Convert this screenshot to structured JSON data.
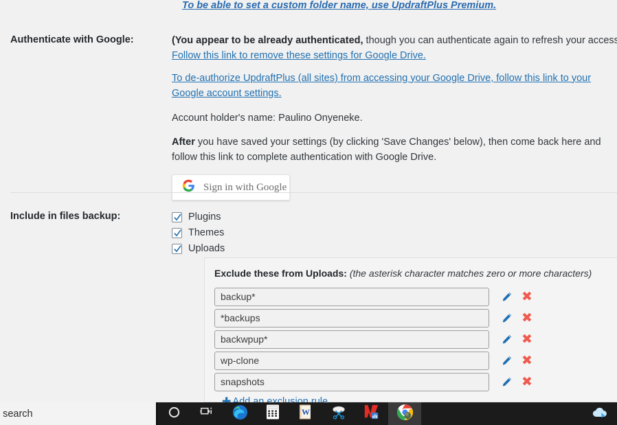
{
  "settings": {
    "premium_link": "To be able to set a custom folder name, use UpdraftPlus Premium.",
    "auth_section": {
      "label": "Authenticate with Google:",
      "para1_bold": "(You appear to be already authenticated,",
      "para1_rest": " though you can authenticate again to refresh your access if you've had a problem). ",
      "para1_link": "Follow this link to remove these settings for Google Drive.",
      "para2_link": "To de-authorize UpdraftPlus (all sites) from accessing your Google Drive, follow this link to your Google account settings.",
      "account_holder": "Account holder's name: Paulino Onyeneke.",
      "para3_bold": "After",
      "para3_rest": " you have saved your settings (by clicking 'Save Changes' below), then come back here and follow this link to complete authentication with Google Drive.",
      "google_button": "Sign in with Google"
    },
    "files_section": {
      "label": "Include in files backup:",
      "checkboxes": [
        {
          "label": "Plugins",
          "checked": true
        },
        {
          "label": "Themes",
          "checked": true
        },
        {
          "label": "Uploads",
          "checked": true
        }
      ]
    },
    "exclusions": {
      "title_bold": "Exclude these from Uploads:",
      "title_italic": "(the asterisk character matches zero or more characters)",
      "rules": [
        {
          "value": "backup*"
        },
        {
          "value": "*backups"
        },
        {
          "value": "backwpup*"
        },
        {
          "value": "wp-clone"
        },
        {
          "value": "snapshots"
        }
      ],
      "add_rule_label": "Add an exclusion rule",
      "edit_icon": "pencil-icon",
      "delete_icon": "x-close-icon",
      "add_icon": "plus-icon"
    }
  },
  "taskbar": {
    "search_placeholder": "o search",
    "items": [
      {
        "name": "cortana",
        "icon": "cortana-circle-icon",
        "active": false
      },
      {
        "name": "task-view",
        "icon": "task-view-icon",
        "active": false
      },
      {
        "name": "microsoft-edge",
        "icon": "edge-icon",
        "active": false
      },
      {
        "name": "calculator",
        "icon": "calculator-icon",
        "active": false
      },
      {
        "name": "wps-writer",
        "icon": "word-document-icon",
        "active": false
      },
      {
        "name": "snipping-tool",
        "icon": "scissors-icon",
        "active": false
      },
      {
        "name": "wps-office",
        "icon": "wps-office-icon",
        "active": false
      },
      {
        "name": "google-chrome",
        "icon": "chrome-icon",
        "active": true
      }
    ],
    "tray": [
      {
        "name": "onedrive",
        "icon": "onedrive-cloud-icon"
      }
    ]
  },
  "colors": {
    "page_bg": "#f1f1f1",
    "link": "#2271b1",
    "text": "#32373c",
    "delete": "#f05a4f",
    "taskbar_bg": "#1b1b1b"
  }
}
